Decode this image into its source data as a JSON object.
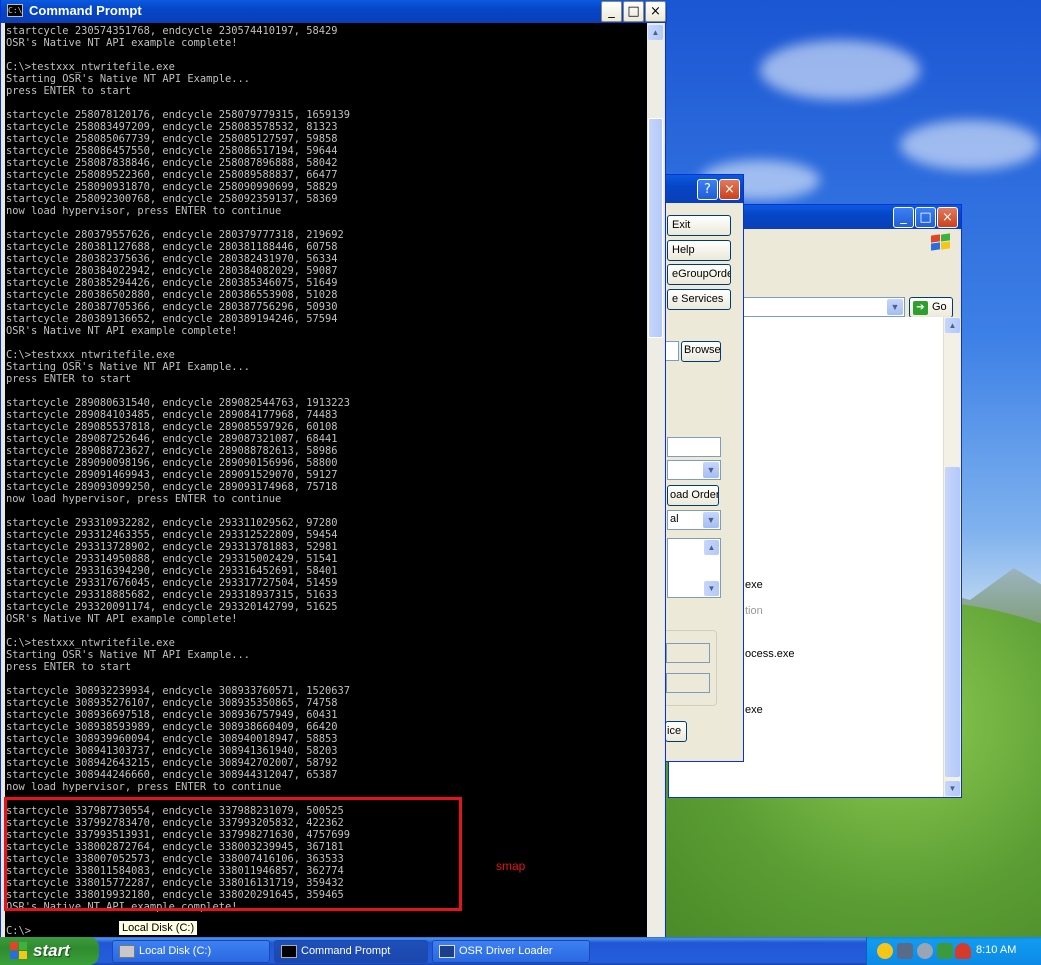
{
  "cmd": {
    "title": "Command Prompt",
    "icon_label": "C:\\",
    "min_glyph": "_",
    "max_glyph": "□",
    "close_glyph": "×",
    "lines": [
      "startcycle 230574351768, endcycle 230574410197, 58429",
      "OSR's Native NT API example complete!",
      "",
      "C:\\>testxxx_ntwritefile.exe",
      "Starting OSR's Native NT API Example...",
      "press ENTER to start",
      "",
      "startcycle 258078120176, endcycle 258079779315, 1659139",
      "startcycle 258083497209, endcycle 258083578532, 81323",
      "startcycle 258085067739, endcycle 258085127597, 59858",
      "startcycle 258086457550, endcycle 258086517194, 59644",
      "startcycle 258087838846, endcycle 258087896888, 58042",
      "startcycle 258089522360, endcycle 258089588837, 66477",
      "startcycle 258090931870, endcycle 258090990699, 58829",
      "startcycle 258092300768, endcycle 258092359137, 58369",
      "now load hypervisor, press ENTER to continue",
      "",
      "startcycle 280379557626, endcycle 280379777318, 219692",
      "startcycle 280381127688, endcycle 280381188446, 60758",
      "startcycle 280382375636, endcycle 280382431970, 56334",
      "startcycle 280384022942, endcycle 280384082029, 59087",
      "startcycle 280385294426, endcycle 280385346075, 51649",
      "startcycle 280386502880, endcycle 280386553908, 51028",
      "startcycle 280387705366, endcycle 280387756296, 50930",
      "startcycle 280389136652, endcycle 280389194246, 57594",
      "OSR's Native NT API example complete!",
      "",
      "C:\\>testxxx_ntwritefile.exe",
      "Starting OSR's Native NT API Example...",
      "press ENTER to start",
      "",
      "startcycle 289080631540, endcycle 289082544763, 1913223",
      "startcycle 289084103485, endcycle 289084177968, 74483",
      "startcycle 289085537818, endcycle 289085597926, 60108",
      "startcycle 289087252646, endcycle 289087321087, 68441",
      "startcycle 289088723627, endcycle 289088782613, 58986",
      "startcycle 289090098196, endcycle 289090156996, 58800",
      "startcycle 289091469943, endcycle 289091529070, 59127",
      "startcycle 289093099250, endcycle 289093174968, 75718",
      "now load hypervisor, press ENTER to continue",
      "",
      "startcycle 293310932282, endcycle 293311029562, 97280",
      "startcycle 293312463355, endcycle 293312522809, 59454",
      "startcycle 293313728902, endcycle 293313781883, 52981",
      "startcycle 293314950888, endcycle 293315002429, 51541",
      "startcycle 293316394290, endcycle 293316452691, 58401",
      "startcycle 293317676045, endcycle 293317727504, 51459",
      "startcycle 293318885682, endcycle 293318937315, 51633",
      "startcycle 293320091174, endcycle 293320142799, 51625",
      "OSR's Native NT API example complete!",
      "",
      "C:\\>testxxx_ntwritefile.exe",
      "Starting OSR's Native NT API Example...",
      "press ENTER to start",
      "",
      "startcycle 308932239934, endcycle 308933760571, 1520637",
      "startcycle 308935276107, endcycle 308935350865, 74758",
      "startcycle 308936697518, endcycle 308936757949, 60431",
      "startcycle 308938593989, endcycle 308938660409, 66420",
      "startcycle 308939960094, endcycle 308940018947, 58853",
      "startcycle 308941303737, endcycle 308941361940, 58203",
      "startcycle 308942643215, endcycle 308942702007, 58792",
      "startcycle 308944246660, endcycle 308944312047, 65387",
      "now load hypervisor, press ENTER to continue",
      "",
      "startcycle 337987730554, endcycle 337988231079, 500525",
      "startcycle 337992783470, endcycle 337993205832, 422362",
      "startcycle 337993513931, endcycle 337998271630, 4757699",
      "startcycle 338002872764, endcycle 338003239945, 367181",
      "startcycle 338007052573, endcycle 338007416106, 363533",
      "startcycle 338011584083, endcycle 338011946857, 362774",
      "startcycle 338015772287, endcycle 338016131719, 359432",
      "startcycle 338019932180, endcycle 338020291645, 359465",
      "OSR's Native NT API example complete!",
      "",
      "C:\\>"
    ],
    "annotation": "smap",
    "tooltip": "Local Disk (C:)"
  },
  "loader": {
    "help_glyph": "?",
    "close_glyph": "×",
    "buttons": [
      "Exit",
      "Help",
      "eGroupOrder",
      "e Services"
    ],
    "browse_label": "Browse",
    "load_order_label": "oad Order",
    "combo2_value": "al",
    "service_button_label": "ice"
  },
  "explorer": {
    "min_glyph": "_",
    "max_glyph": "□",
    "close_glyph": "×",
    "go_label": "Go",
    "items": [
      "exe",
      "tion",
      "ocess.exe",
      "exe"
    ]
  },
  "taskbar": {
    "start_label": "start",
    "items": [
      "Local Disk (C:)",
      "Command Prompt",
      "OSR Driver Loader"
    ],
    "clock": "8:10 AM"
  },
  "colors": {
    "annotation_red": "#e5131d",
    "console_bg": "#000000",
    "console_text": "#c0c0c0",
    "xp_blue": "#0a5ae0"
  }
}
